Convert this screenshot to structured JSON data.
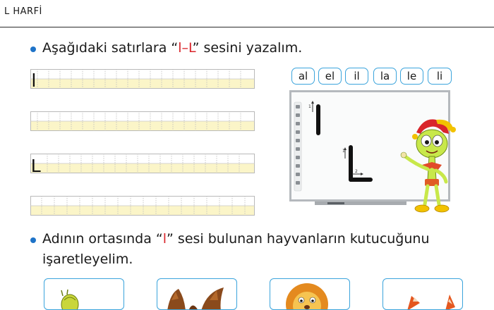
{
  "header": {
    "title": "L HARFİ"
  },
  "instruction1": {
    "before": "Aşağıdaki satırlara “",
    "letters": "l–L",
    "after": "” sesini yazalım."
  },
  "writing_rows": [
    {
      "model_letter": "l"
    },
    {
      "model_letter": ""
    },
    {
      "model_letter": "L"
    },
    {
      "model_letter": ""
    }
  ],
  "syllables": [
    "al",
    "el",
    "il",
    "la",
    "le",
    "li"
  ],
  "board": {
    "stroke_l": "1",
    "stroke_L1": "1",
    "stroke_L2": "2"
  },
  "instruction2": {
    "line1_before": "Adının ortasında “",
    "letter": "l",
    "line1_after": "” sesi bulunan hayvanların kutucuğunu",
    "line2": "işaretleyelim."
  },
  "colors": {
    "accent": "#1e73c8",
    "box_border": "#3ba4dc",
    "highlight_red": "#d9252b",
    "row_fill": "#fbf5c8",
    "row_line": "#c7c7c7"
  },
  "icons": [
    "letter-l-writing-board",
    "mascot-character",
    "snail-icon",
    "eagle-icon",
    "lion-icon",
    "fox-icon"
  ]
}
